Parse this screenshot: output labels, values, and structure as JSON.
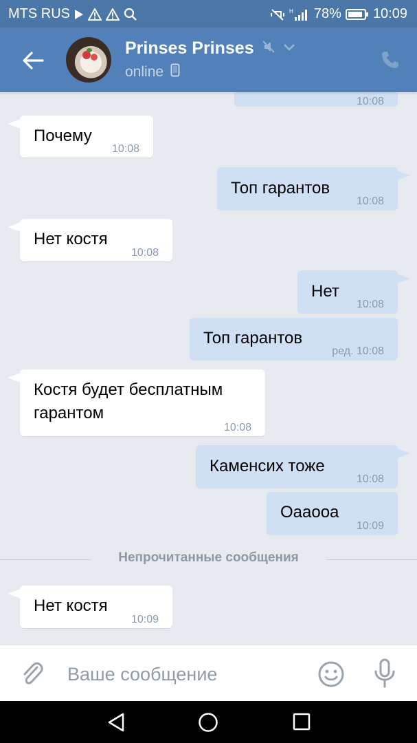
{
  "status_bar": {
    "carrier": "MTS RUS",
    "battery": "78%",
    "time": "10:09"
  },
  "header": {
    "contact_name": "Prinses Prinses",
    "status": "online"
  },
  "messages": [
    {
      "direction": "out",
      "text": "",
      "time": "10:08",
      "edited": ""
    },
    {
      "direction": "in",
      "text": "Почему",
      "time": "10:08",
      "edited": ""
    },
    {
      "direction": "out",
      "text": "Топ гарантов",
      "time": "10:08",
      "edited": ""
    },
    {
      "direction": "in",
      "text": "Нет костя",
      "time": "10:08",
      "edited": ""
    },
    {
      "direction": "out",
      "text": "Нет",
      "time": "10:08",
      "edited": ""
    },
    {
      "direction": "out",
      "text": "Топ гарантов",
      "time": "10:08",
      "edited": "ред."
    },
    {
      "direction": "in",
      "text": "Костя будет бесплатным\nгарантом",
      "time": "10:08",
      "edited": ""
    },
    {
      "direction": "out",
      "text": "Каменсих тоже",
      "time": "10:08",
      "edited": ""
    },
    {
      "direction": "out",
      "text": "Оааоoa",
      "time": "10:09",
      "edited": ""
    },
    {
      "direction": "in",
      "text": "Нет костя",
      "time": "10:09",
      "edited": ""
    }
  ],
  "unread_divider": "Непрочитанные сообщения",
  "composer": {
    "placeholder": "Ваше сообщение"
  },
  "colors": {
    "header": "#5181b8",
    "status_bar": "#4a76a8",
    "chat_background": "#e7ebf0",
    "incoming_bubble": "#ffffff",
    "outgoing_bubble": "#cfe0f5"
  },
  "icons": [
    "back-arrow-icon",
    "muted-icon",
    "chevron-down-icon",
    "mobile-icon",
    "phone-icon",
    "paperclip-icon",
    "smiley-icon",
    "microphone-icon",
    "nav-back-icon",
    "nav-home-icon",
    "nav-recents-icon"
  ]
}
